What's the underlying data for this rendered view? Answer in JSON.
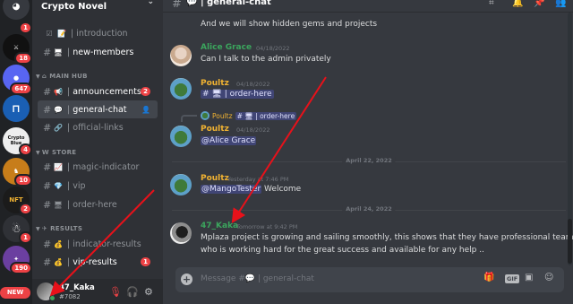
{
  "server": {
    "name": "Crypto Novel",
    "rail_badges": [
      "1",
      "18",
      "647",
      "4",
      "10",
      "2",
      "1",
      "190"
    ],
    "rail_labels": [
      "Crypto Blue",
      "NFT"
    ],
    "new_label": "NEW"
  },
  "sidebar": {
    "channels_top": [
      {
        "emoji": "📝",
        "name": "introduction"
      },
      {
        "emoji": "🖥",
        "name": "new-members"
      }
    ],
    "main_hub": {
      "label": "MAIN HUB",
      "channels": [
        {
          "emoji": "📢",
          "name": "announcements",
          "badge": "2"
        },
        {
          "emoji": "💬",
          "name": "general-chat"
        },
        {
          "emoji": "🔗",
          "name": "official-links"
        }
      ]
    },
    "store": {
      "label": "STORE",
      "channels": [
        {
          "emoji": "📈",
          "name": "magic-indicator"
        },
        {
          "emoji": "💎",
          "name": "vip"
        },
        {
          "emoji": "🖥",
          "name": "order-here"
        }
      ]
    },
    "results": {
      "label": "RESULTS",
      "channels": [
        {
          "emoji": "💰",
          "name": "indicator-results"
        },
        {
          "emoji": "💰",
          "name": "vip-results",
          "badge": "1"
        }
      ]
    }
  },
  "user": {
    "name": "47_Kaka",
    "tag": "#7082"
  },
  "header": {
    "emoji": "💬",
    "channel": "general-chat"
  },
  "messages": {
    "m0_text": "And we will show hidden gems and projects",
    "alice": {
      "author": "Alice Grace",
      "time": "04/18/2022",
      "text": "Can I talk to the admin privately"
    },
    "poultz1": {
      "author": "Poultz",
      "time": "04/18/2022",
      "link_emoji": "🖥",
      "link": "order-here"
    },
    "poultz2": {
      "reply_author": "Poultz",
      "reply_link": "order-here",
      "author": "Poultz",
      "time": "04/18/2022",
      "mention": "@Alice Grace"
    },
    "divider1": "April 22, 2022",
    "poultz3": {
      "author": "Poultz",
      "time": "Yesterday at 7:46 PM",
      "mention": "@MangoTester",
      "text": " Welcome"
    },
    "divider2": "April 24, 2022",
    "kaka": {
      "author": "47_Kaka",
      "time": "Tomorrow at 9:42 PM",
      "line1": "Mplaza project is growing and sailing smoothly, this shows that they have professional team",
      "line2": "who is working hard for the great success and available for any help .."
    }
  },
  "composer": {
    "placeholder_prefix": "Message #💬 | ",
    "placeholder_channel": "general-chat",
    "gif": "GIF"
  },
  "colors": {
    "alice": "#3ba55d",
    "poultz": "#f0b232",
    "kaka": "#3ba55d",
    "arrow": "#e8111a"
  }
}
